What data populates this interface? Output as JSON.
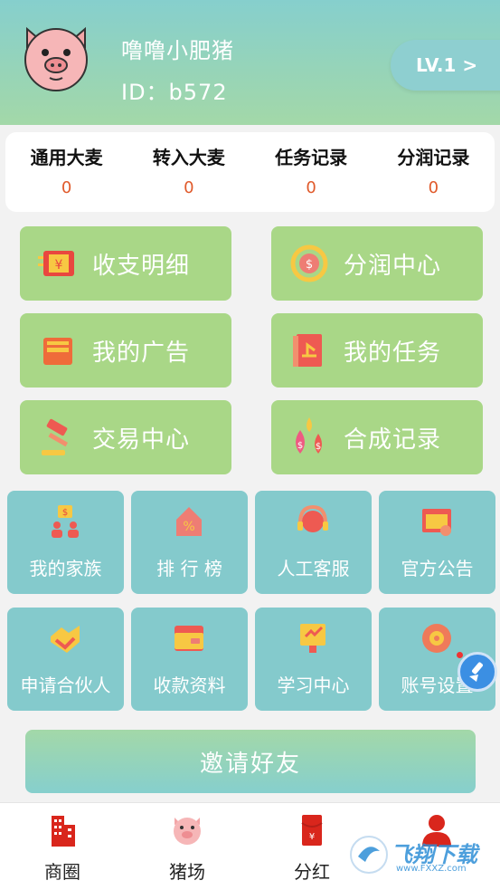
{
  "profile": {
    "name": "噜噜小肥猪",
    "id": "ID：b572",
    "level": "LV.1  >"
  },
  "stats": [
    {
      "label": "通用大麦",
      "value": "0"
    },
    {
      "label": "转入大麦",
      "value": "0"
    },
    {
      "label": "任务记录",
      "value": "0"
    },
    {
      "label": "分润记录",
      "value": "0"
    }
  ],
  "main_buttons": [
    {
      "label": "收支明细",
      "icon": "bill-icon"
    },
    {
      "label": "分润中心",
      "icon": "coin-cycle-icon"
    },
    {
      "label": "我的广告",
      "icon": "ad-card-icon"
    },
    {
      "label": "我的任务",
      "icon": "task-book-icon"
    },
    {
      "label": "交易中心",
      "icon": "gavel-icon"
    },
    {
      "label": "合成记录",
      "icon": "drops-icon"
    }
  ],
  "tiles": [
    {
      "label": "我的家族",
      "icon": "family-icon"
    },
    {
      "label": "排 行 榜",
      "icon": "ranking-icon"
    },
    {
      "label": "人工客服",
      "icon": "headset-icon"
    },
    {
      "label": "官方公告",
      "icon": "announcement-icon"
    },
    {
      "label": "申请合伙人",
      "icon": "handshake-icon"
    },
    {
      "label": "收款资料",
      "icon": "wallet-card-icon"
    },
    {
      "label": "学习中心",
      "icon": "study-icon"
    },
    {
      "label": "账号设置",
      "icon": "settings-icon"
    }
  ],
  "invite_label": "邀请好友",
  "tabbar": [
    {
      "label": "商圈",
      "icon": "building-icon"
    },
    {
      "label": "猪场",
      "icon": "pig-icon"
    },
    {
      "label": "分红",
      "icon": "red-envelope-icon"
    },
    {
      "label": "",
      "icon": "person-icon"
    }
  ],
  "watermark": {
    "title": "飞翔下载",
    "url": "www.FXXZ.com"
  },
  "colors": {
    "header_top": "#86cfcd",
    "header_bottom": "#a3d8a8",
    "green_button": "#a9d787",
    "teal_tile": "#84cacc",
    "stat_value": "#e05a2b",
    "tab_icon_red": "#d9261c"
  }
}
